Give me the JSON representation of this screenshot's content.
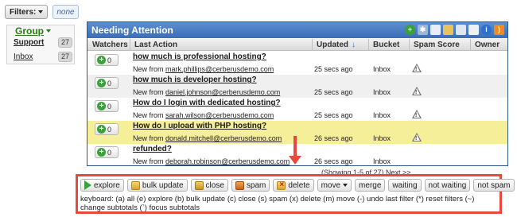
{
  "filters": {
    "label": "Filters:",
    "value": "none"
  },
  "group": {
    "header": "Group",
    "items": [
      {
        "label": "Support",
        "count": "27",
        "bold": true
      },
      {
        "label": "Inbox",
        "count": "27",
        "bold": false
      }
    ]
  },
  "worklist": {
    "title": "Needing Attention",
    "toolbar_icons": [
      "add-icon",
      "gear-icon",
      "copy-icon",
      "folder-icon",
      "export-icon",
      "print-icon",
      "info-icon",
      "rss-icon"
    ],
    "columns": [
      "Watchers",
      "Last Action",
      "Updated",
      "Bucket",
      "Spam Score",
      "Owner"
    ],
    "rows": [
      {
        "watchers": "0",
        "subject": "how much is professional hosting?",
        "from_prefix": "New from ",
        "email": "mark.phillips@cerberusdemo.com",
        "updated": "25 secs ago",
        "bucket": "Inbox",
        "highlight": "none"
      },
      {
        "watchers": "0",
        "subject": "how much is developer hosting?",
        "from_prefix": "New from ",
        "email": "daniel.johnson@cerberusdemo.com",
        "updated": "25 secs ago",
        "bucket": "Inbox",
        "highlight": "gray"
      },
      {
        "watchers": "0",
        "subject": "How do I login with dedicated hosting?",
        "from_prefix": "New from ",
        "email": "sarah.wilson@cerberusdemo.com",
        "updated": "25 secs ago",
        "bucket": "Inbox",
        "highlight": "none"
      },
      {
        "watchers": "0",
        "subject": "How do I upload with PHP hosting?",
        "from_prefix": "New from ",
        "email": "donald.mitchell@cerberusdemo.com",
        "updated": "26 secs ago",
        "bucket": "Inbox",
        "highlight": "yellow"
      },
      {
        "watchers": "0",
        "subject": "refunded?",
        "from_prefix": "New from ",
        "email": "deborah.robinson@cerberusdemo.com",
        "updated": "26 secs ago",
        "bucket": "Inbox",
        "highlight": "none"
      }
    ],
    "showing": "(Showing 1-5 of 27) Next >>"
  },
  "bulk": {
    "buttons": {
      "explore": "explore",
      "bulk_update": "bulk update",
      "close": "close",
      "spam": "spam",
      "delete": "delete",
      "move": "move",
      "merge": "merge",
      "waiting": "waiting",
      "not_waiting": "not waiting",
      "not_spam": "not spam"
    },
    "keyboard": "keyboard: (a) all (e) explore (b) bulk update (c) close (s) spam (x) delete (m) move (-) undo last filter (*) reset filters (~) change subtotals (`) focus subtotals"
  },
  "colors": {
    "titlebar": "#4a7fc4",
    "highlight_row": "#f6ef9a",
    "callout": "#e8493c",
    "group_accent": "#2b7a15"
  }
}
